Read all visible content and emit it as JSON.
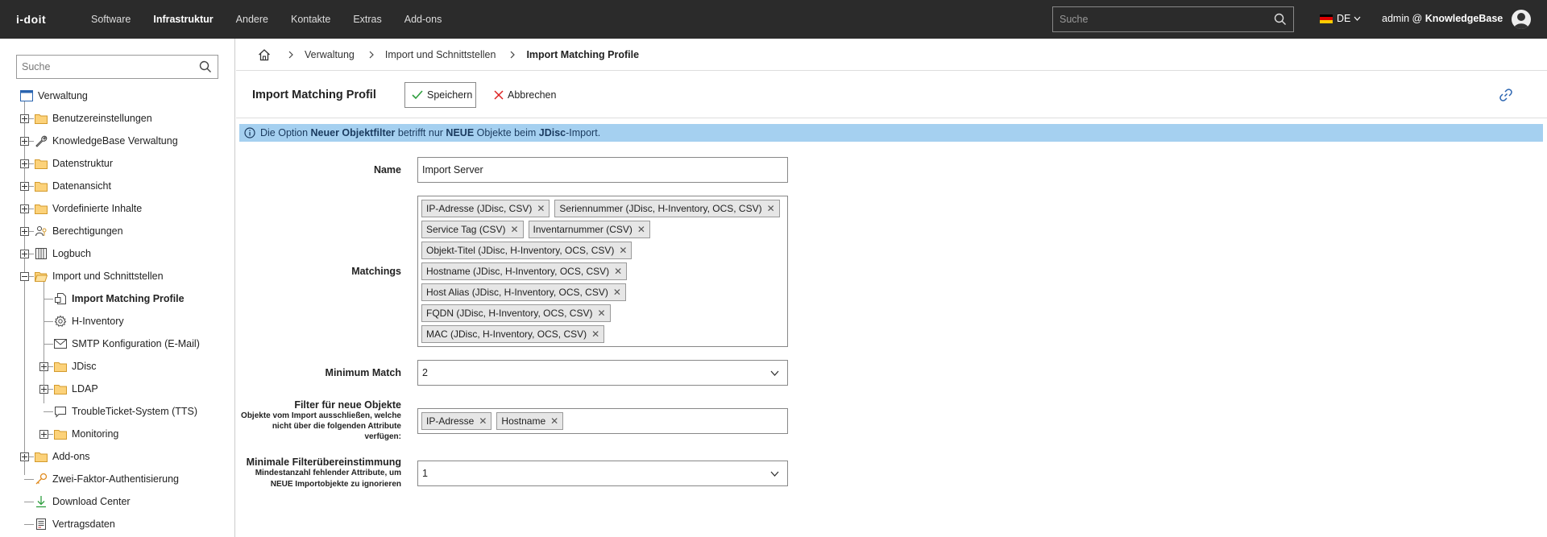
{
  "topnav": {
    "logo": "i-doit",
    "items": [
      "Software",
      "Infrastruktur",
      "Andere",
      "Kontakte",
      "Extras",
      "Add-ons"
    ],
    "active_index": 1,
    "search_placeholder": "Suche",
    "language": "DE",
    "user_prefix": "admin @",
    "tenant": "KnowledgeBase"
  },
  "sidebar": {
    "search_placeholder": "Suche",
    "root": "Verwaltung",
    "items": [
      {
        "label": "Benutzereinstellungen",
        "icon": "folder-icon"
      },
      {
        "label": "KnowledgeBase Verwaltung",
        "icon": "wrench-icon"
      },
      {
        "label": "Datenstruktur",
        "icon": "folder-icon"
      },
      {
        "label": "Datenansicht",
        "icon": "folder-icon"
      },
      {
        "label": "Vordefinierte Inhalte",
        "icon": "folder-icon"
      },
      {
        "label": "Berechtigungen",
        "icon": "permissions-icon"
      },
      {
        "label": "Logbuch",
        "icon": "logbook-icon"
      },
      {
        "label": "Import und Schnittstellen",
        "icon": "folder-open-icon"
      },
      {
        "label": "Import Matching Profile",
        "icon": "document-icon"
      },
      {
        "label": "H-Inventory",
        "icon": "gear-icon"
      },
      {
        "label": "SMTP Konfiguration (E-Mail)",
        "icon": "mail-icon"
      },
      {
        "label": "JDisc",
        "icon": "folder-icon"
      },
      {
        "label": "LDAP",
        "icon": "folder-icon"
      },
      {
        "label": "TroubleTicket-System (TTS)",
        "icon": "chat-icon"
      },
      {
        "label": "Monitoring",
        "icon": "folder-icon"
      },
      {
        "label": "Add-ons",
        "icon": "folder-icon"
      },
      {
        "label": "Zwei-Faktor-Authentisierung",
        "icon": "key-icon"
      },
      {
        "label": "Download Center",
        "icon": "download-icon"
      },
      {
        "label": "Vertragsdaten",
        "icon": "contract-icon"
      }
    ]
  },
  "breadcrumb": [
    "Verwaltung",
    "Import und Schnittstellen",
    "Import Matching Profile"
  ],
  "header": {
    "title": "Import Matching Profil",
    "save_label": "Speichern",
    "cancel_label": "Abbrechen"
  },
  "info": {
    "p1": "Die Option ",
    "b1": "Neuer Objektfilter",
    "p2": " betrifft nur ",
    "b2": "NEUE",
    "p3": " Objekte beim ",
    "b3": "JDisc",
    "p4": "-Import."
  },
  "form": {
    "name_label": "Name",
    "name_value": "Import Server",
    "matchings_label": "Matchings",
    "matchings": [
      "IP-Adresse (JDisc, CSV)",
      "Seriennummer (JDisc, H-Inventory, OCS, CSV)",
      "Service Tag (CSV)",
      "Inventarnummer (CSV)",
      "Objekt-Titel (JDisc, H-Inventory, OCS, CSV)",
      "Hostname (JDisc, H-Inventory, OCS, CSV)",
      "Host Alias (JDisc, H-Inventory, OCS, CSV)",
      "FQDN (JDisc, H-Inventory, OCS, CSV)",
      "MAC (JDisc, H-Inventory, OCS, CSV)"
    ],
    "minmatch_label": "Minimum Match",
    "minmatch_value": "2",
    "filter_label": "Filter für neue Objekte",
    "filter_sub1": "Objekte vom Import ausschließen, welche",
    "filter_sub2": "nicht über die folgenden Attribute",
    "filter_sub3": "verfügen:",
    "filter_chips": [
      "IP-Adresse",
      "Hostname"
    ],
    "minfilter_label": "Minimale Filterübereinstimmung",
    "minfilter_sub1": "Mindestanzahl fehlender Attribute, um",
    "minfilter_sub2": "NEUE Importobjekte zu ignorieren",
    "minfilter_value": "1"
  }
}
